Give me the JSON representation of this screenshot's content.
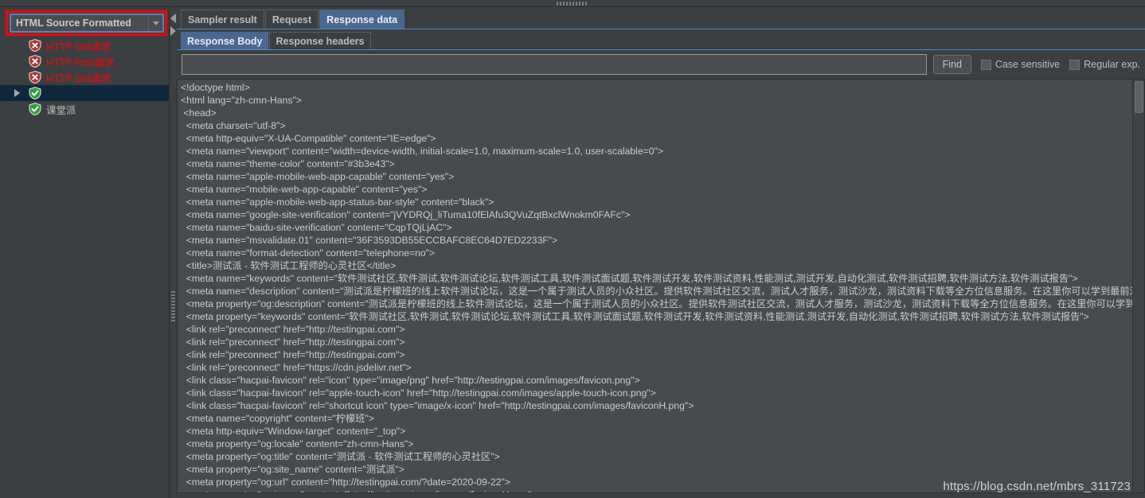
{
  "window": {
    "splitter_grip": "horizontal-splitter"
  },
  "sidebar": {
    "view_selector": {
      "selected": "HTML Source Formatted",
      "arrow_icon": "chevron-down-icon"
    },
    "tree_items": [
      {
        "label": "HTTP Get请求",
        "status": "fail",
        "icon": "shield-error-icon",
        "expanded": false,
        "selected": false
      },
      {
        "label": "HTTP Post请求",
        "status": "fail",
        "icon": "shield-error-icon",
        "expanded": false,
        "selected": false
      },
      {
        "label": "HTTP Get请求",
        "status": "fail",
        "icon": "shield-error-icon",
        "expanded": false,
        "selected": false
      },
      {
        "label": "",
        "status": "pass",
        "icon": "shield-ok-icon",
        "expanded": true,
        "selected": true
      },
      {
        "label": "课堂派",
        "status": "pass",
        "icon": "shield-ok-icon",
        "expanded": false,
        "selected": false
      }
    ]
  },
  "main": {
    "tabs": [
      {
        "label": "Sampler result",
        "active": false
      },
      {
        "label": "Request",
        "active": false
      },
      {
        "label": "Response data",
        "active": true
      }
    ],
    "subtabs": [
      {
        "label": "Response Body",
        "active": true
      },
      {
        "label": "Response headers",
        "active": false
      }
    ],
    "findbar": {
      "search_value": "",
      "search_placeholder": "",
      "find_label": "Find",
      "case_sensitive_label": "Case sensitive",
      "case_sensitive_checked": false,
      "regular_exp_label": "Regular exp.",
      "regular_exp_checked": false
    },
    "source_lines": [
      "<!doctype html>",
      "<html lang=\"zh-cmn-Hans\">",
      " <head>",
      "  <meta charset=\"utf-8\">",
      "  <meta http-equiv=\"X-UA-Compatible\" content=\"IE=edge\">",
      "  <meta name=\"viewport\" content=\"width=device-width, initial-scale=1.0, maximum-scale=1.0, user-scalable=0\">",
      "  <meta name=\"theme-color\" content=\"#3b3e43\">",
      "  <meta name=\"apple-mobile-web-app-capable\" content=\"yes\">",
      "  <meta name=\"mobile-web-app-capable\" content=\"yes\">",
      "  <meta name=\"apple-mobile-web-app-status-bar-style\" content=\"black\">",
      "  <meta name=\"google-site-verification\" content=\"jVYDRQj_liTuma10fElAfu3QVuZqtBxclWnokm0FAFc\">",
      "  <meta name=\"baidu-site-verification\" content=\"CqpTQjLjAC\">",
      "  <meta name=\"msvalidate.01\" content=\"36F3593DB55ECCBAFC8EC64D7ED2233F\">",
      "  <meta name=\"format-detection\" content=\"telephone=no\">",
      "  <title>测试派 - 软件测试工程师的心灵社区</title>",
      "  <meta name=\"keywords\" content=\"软件测试社区,软件测试,软件测试论坛,软件测试工具,软件测试面试题,软件测试开发,软件测试资料,性能测试,测试开发,自动化测试,软件测试招聘,软件测试方法,软件测试报告\">",
      "  <meta name=\"description\" content=\"测试派是柠檬班的线上软件测试论坛，这是一个属于测试人员的小众社区。提供软件测试社区交流，测试人才服务，测试沙龙，测试资料下载等全方位信息服务。在这里你可以学到最前沿",
      "  <meta property=\"og:description\" content=\"测试派是柠檬班的线上软件测试论坛，这是一个属于测试人员的小众社区。提供软件测试社区交流，测试人才服务，测试沙龙，测试资料下载等全方位信息服务。在这里你可以学到",
      "  <meta property=\"keywords\" content=\"软件测试社区,软件测试,软件测试论坛,软件测试工具,软件测试面试题,软件测试开发,软件测试资料,性能测试,测试开发,自动化测试,软件测试招聘,软件测试方法,软件测试报告\">",
      "  <link rel=\"preconnect\" href=\"http://testingpai.com\">",
      "  <link rel=\"preconnect\" href=\"http://testingpai.com\">",
      "  <link rel=\"preconnect\" href=\"http://testingpai.com\">",
      "  <link rel=\"preconnect\" href=\"https://cdn.jsdelivr.net\">",
      "  <link class=\"hacpai-favicon\" rel=\"icon\" type=\"image/png\" href=\"http://testingpai.com/images/favicon.png\">",
      "  <link class=\"hacpai-favicon\" rel=\"apple-touch-icon\" href=\"http://testingpai.com/images/apple-touch-icon.png\">",
      "  <link class=\"hacpai-favicon\" rel=\"shortcut icon\" type=\"image/x-icon\" href=\"http://testingpai.com/images/faviconH.png\">",
      "  <meta name=\"copyright\" content=\"柠檬班\">",
      "  <meta http-equiv=\"Window-target\" content=\"_top\">",
      "  <meta property=\"og:locale\" content=\"zh-cmn-Hans\">",
      "  <meta property=\"og:title\" content=\"测试派 - 软件测试工程师的心灵社区\">",
      "  <meta property=\"og:site_name\" content=\"测试派\">",
      "  <meta property=\"og:url\" content=\"http://testingpai.com/?date=2020-09-22\">",
      "  <meta property=\"og:image\" content=\"http://testingpai.com/images/faviconH.png\">"
    ]
  },
  "watermark": {
    "text": "https://blog.csdn.net/mbrs_311723"
  },
  "colors": {
    "accent": "#4a88c7",
    "tab_active": "#4a688f",
    "annotation": "#ff0000",
    "fail_text": "#ff0000",
    "panel_bg": "#3c3f41",
    "source_bg": "#474b4e"
  }
}
